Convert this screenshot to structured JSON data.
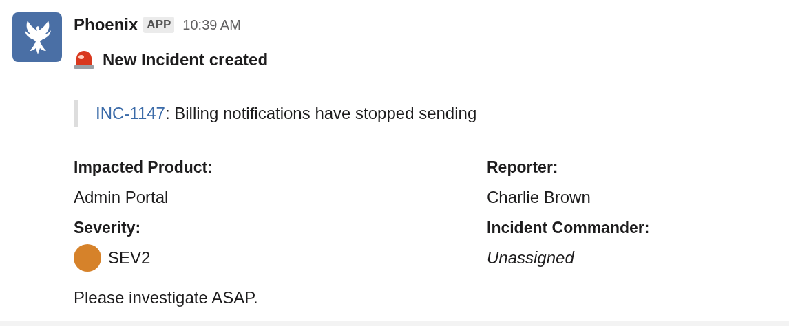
{
  "message": {
    "sender": "Phoenix",
    "badge": "APP",
    "time": "10:39 AM",
    "title": "New Incident created",
    "quote": {
      "link": "INC-1147",
      "text": ": Billing notifications have stopped sending"
    },
    "fields": [
      {
        "label": "Impacted Product:",
        "value": "Admin Portal",
        "kind": "plain"
      },
      {
        "label": "Reporter:",
        "value": "Charlie Brown",
        "kind": "plain"
      },
      {
        "label": "Severity:",
        "value": "SEV2",
        "kind": "severity",
        "color": "#d6822a"
      },
      {
        "label": "Incident Commander:",
        "value": "Unassigned",
        "kind": "empty"
      }
    ],
    "footer": "Please investigate ASAP."
  }
}
